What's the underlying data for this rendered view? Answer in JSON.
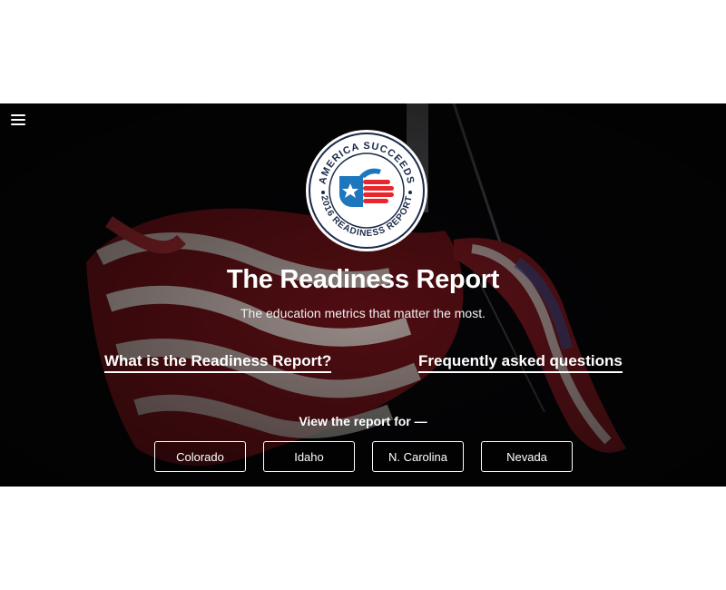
{
  "logo": {
    "ring_top_text": "AMERICA SUCCEEDS",
    "ring_bottom_text": "2016 READINESS REPORT"
  },
  "hero": {
    "title": "The Readiness Report",
    "subtitle": "The education metrics that matter the most."
  },
  "links": {
    "what": "What is the Readiness Report?",
    "faq": "Frequently asked questions"
  },
  "view_label": "View the report for —",
  "states": [
    "Colorado",
    "Idaho",
    "N. Carolina",
    "Nevada"
  ],
  "colors": {
    "brand_red": "#e8262c",
    "brand_blue": "#1e76bd",
    "navy": "#1b2a4a"
  }
}
